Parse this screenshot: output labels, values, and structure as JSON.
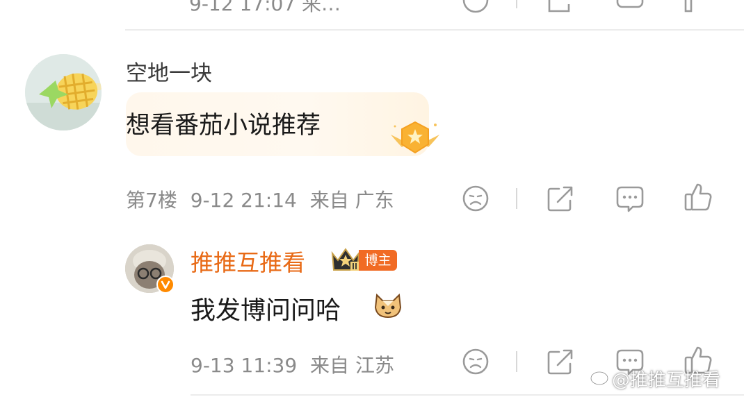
{
  "top_meta": {
    "text": "9-12 17:07 来…"
  },
  "comment": {
    "username": "空地一块",
    "text": "想看番茄小说推荐",
    "floor": "第7楼",
    "time": "9-12 21:14",
    "location": "来自 广东"
  },
  "reply": {
    "username": "推推互推看",
    "badge": "博主",
    "text": "我发博问问哈",
    "time": "9-13 11:39",
    "location": "来自 江苏"
  },
  "watermark": "@推推互推看",
  "icons": [
    "sad-face-icon",
    "share-icon",
    "comment-icon",
    "like-icon",
    "crown-badge-icon",
    "verified-icon",
    "cat-emoji-icon",
    "vip-medal-icon"
  ],
  "colors": {
    "accent": "#e86a16",
    "meta": "#8a8a8a",
    "badge": "#f16b24",
    "verified": "#ff8a00"
  }
}
